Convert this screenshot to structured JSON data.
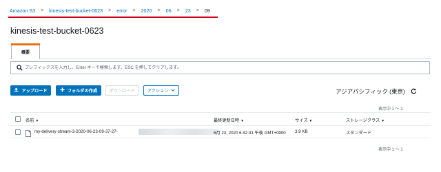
{
  "breadcrumb": {
    "items": [
      "Amazon S3",
      "kinesis-test-bucket-0623",
      "error",
      "2020",
      "06",
      "23",
      "09"
    ],
    "separator": ">"
  },
  "page_title": "kinesis-test-bucket-0623",
  "tabs": [
    {
      "label": "概要"
    }
  ],
  "search": {
    "placeholder": "プレフィックスを入力し、Enter キーで検索します。ESC を押してクリアします。"
  },
  "toolbar": {
    "upload_label": "アップロード",
    "create_folder_label": "フォルダの作成",
    "download_label": "ダウンロード",
    "actions_label": "アクション"
  },
  "region": "アジアパシフィック (東京)",
  "count_top": "表示中 1 ～ 1",
  "count_bottom": "表示中 1 ～ 1",
  "table": {
    "columns": {
      "name": "名前",
      "last_modified": "最終更新日時",
      "size": "サイズ",
      "storage_class": "ストレージクラス"
    },
    "rows": [
      {
        "name": "my-delivery-stream-3-2020-06-23-09-37-27-",
        "last_modified": "6月 23, 2020 6:42:31 午後 GMT+0900",
        "size": "3.9 KB",
        "storage_class": "スタンダード"
      }
    ]
  },
  "colors": {
    "link": "#0073bb",
    "primary_button": "#0073bb",
    "tab_accent": "#ec7211",
    "annotation_underline": "#d0021b"
  }
}
